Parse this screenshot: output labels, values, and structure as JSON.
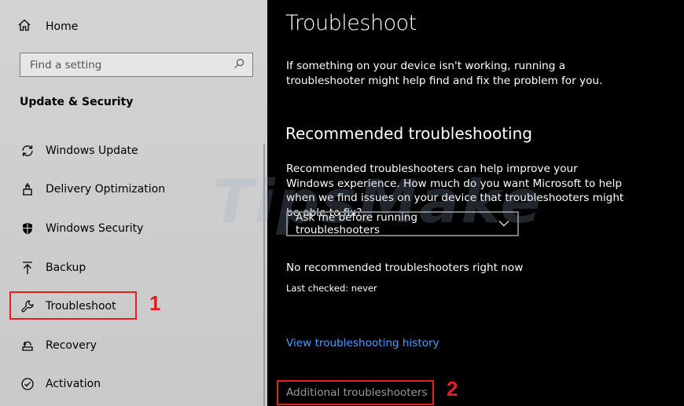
{
  "sidebar": {
    "home_label": "Home",
    "search_placeholder": "Find a setting",
    "section_title": "Update & Security",
    "items": [
      {
        "label": "Windows Update",
        "icon": "sync-icon"
      },
      {
        "label": "Delivery Optimization",
        "icon": "delivery-icon"
      },
      {
        "label": "Windows Security",
        "icon": "shield-icon"
      },
      {
        "label": "Backup",
        "icon": "backup-icon"
      },
      {
        "label": "Troubleshoot",
        "icon": "wrench-icon"
      },
      {
        "label": "Recovery",
        "icon": "recovery-icon"
      },
      {
        "label": "Activation",
        "icon": "checkmark-circle-icon"
      }
    ]
  },
  "annotations": {
    "step1": "1",
    "step2": "2",
    "color": "#e61e1e"
  },
  "main": {
    "title": "Troubleshoot",
    "intro": "If something on your device isn't working, running a troubleshooter might help find and fix the problem for you.",
    "recommended_title": "Recommended troubleshooting",
    "recommended_desc": "Recommended troubleshooters can help improve your Windows experience. How much do you want Microsoft to help when we find issues on your device that troubleshooters might be able to fix?",
    "dropdown_value": "Ask me before running troubleshooters",
    "status": "No recommended troubleshooters right now",
    "last_checked": "Last checked: never",
    "history_link": "View troubleshooting history",
    "additional_link": "Additional troubleshooters",
    "link_color": "#4a9eff"
  },
  "watermark": "TipsMake"
}
